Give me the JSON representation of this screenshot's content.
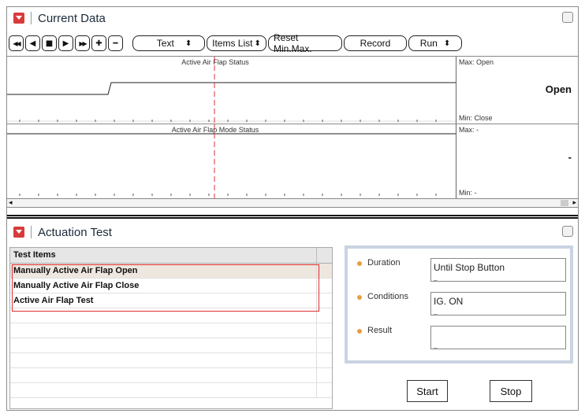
{
  "current_data": {
    "title": "Current Data",
    "toolbar": {
      "rewind_glyph": "◀◀",
      "back_glyph": "◀",
      "stop_glyph": "■",
      "play_glyph": "▶",
      "forward_glyph": "▶▶",
      "plus_glyph": "✚",
      "minus_glyph": "━",
      "text_label": "Text",
      "items_list_label": "Items List",
      "reset_label": "Reset Min.Max.",
      "record_label": "Record",
      "run_label": "Run",
      "select_arrows": "⬍"
    },
    "graphs": [
      {
        "title": "Active Air Flap Status",
        "max_label": "Max: Open",
        "min_label": "Min: Close",
        "current_value": "Open"
      },
      {
        "title": "Active Air Flap Mode Status",
        "max_label": "Max: -",
        "min_label": "Min: -",
        "current_value": "-"
      }
    ],
    "scroll_left_glyph": "◂",
    "scroll_right_glyph": "▸"
  },
  "actuation_test": {
    "title": "Actuation Test",
    "list_header": "Test Items",
    "items": [
      "Manually Active Air Flap Open",
      "Manually Active Air Flap Close",
      "Active Air Flap Test"
    ],
    "selected_index": 0,
    "fields": {
      "duration_label": "Duration",
      "duration_value": "Until Stop Button",
      "conditions_label": "Conditions",
      "conditions_value": "IG. ON",
      "result_label": "Result",
      "result_value": "",
      "field_tick": "_"
    },
    "start_label": "Start",
    "stop_label": "Stop"
  },
  "colors": {
    "collapse_button": "#d93b3b",
    "cursor_line": "#e03030",
    "selection_box": "#e03030",
    "bullet": "#e6a040",
    "detail_border": "#c9d3e2"
  }
}
